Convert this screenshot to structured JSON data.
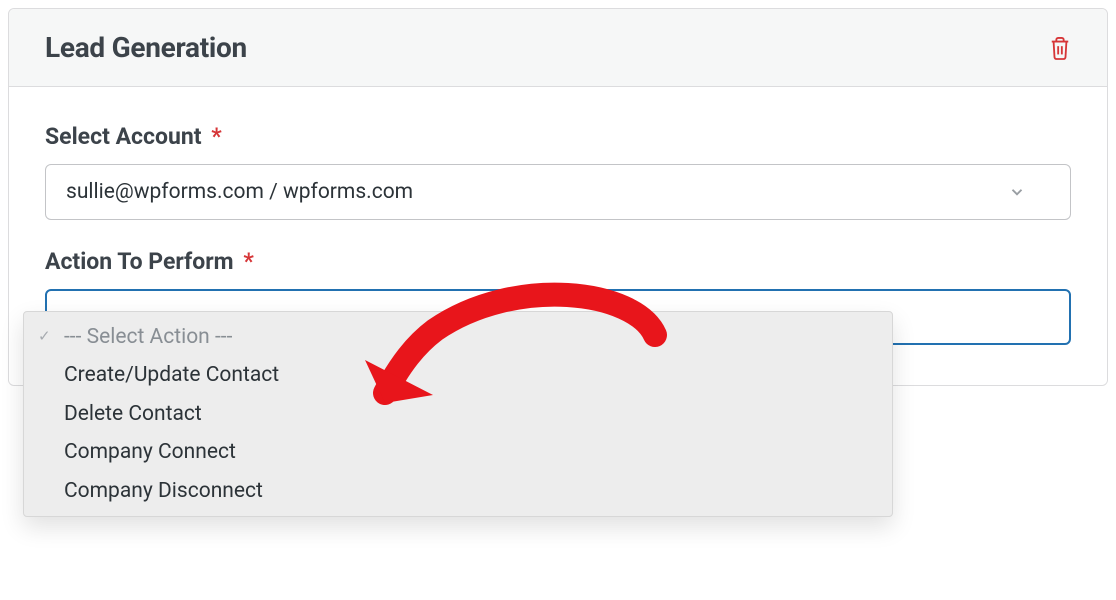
{
  "panel": {
    "title": "Lead Generation"
  },
  "account": {
    "label": "Select Account",
    "value": "sullie@wpforms.com / wpforms.com"
  },
  "action": {
    "label": "Action To Perform",
    "placeholder": "--- Select Action ---",
    "options": [
      "Create/Update Contact",
      "Delete Contact",
      "Company Connect",
      "Company Disconnect"
    ]
  }
}
